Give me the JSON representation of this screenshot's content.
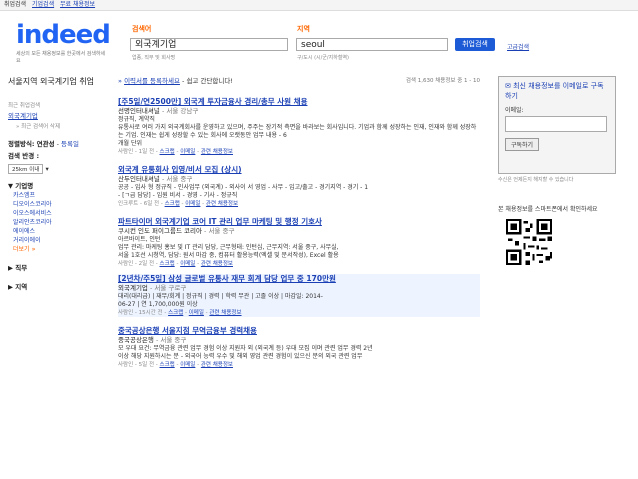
{
  "topbar": {
    "title": "취업검색",
    "links": [
      "기업검색",
      "무료 채용정보"
    ]
  },
  "logo": {
    "word": "indeed",
    "tagline": "세상의 모든 채용정보를 한곳에서 검색하세요"
  },
  "search": {
    "what_label": "검색어",
    "what_value": "외국계기업",
    "what_hint": "업종, 직무 및 회사명",
    "where_label": "지역",
    "where_value": "seoul",
    "where_hint": "구/도시 (시/군/지하철역)",
    "button": "취업검색",
    "advanced": "고급검색"
  },
  "sidebar": {
    "title": "서울지역 외국계기업 취업",
    "recent_label": "최근 취업검색",
    "recent": [
      "외국계기업"
    ],
    "recent_clear": "» 최근 검색어 삭제",
    "sort_label": "정렬방식:",
    "sort_value": "연관성",
    "sort_alt": "등록일",
    "radius_label": "검색 반경 :",
    "radius_value": "25km 이내",
    "section_type": "▼ 기업명",
    "types": [
      {
        "name": "카스엠프",
        "count": ""
      },
      {
        "name": "디오이스코리아",
        "count": ""
      },
      {
        "name": "이오스에서비스",
        "count": ""
      },
      {
        "name": "알리안츠코리아",
        "count": ""
      },
      {
        "name": "에이에스",
        "count": ""
      },
      {
        "name": "거리이에이",
        "count": ""
      },
      {
        "name": "더보기",
        "count": "»"
      }
    ],
    "section_job": "▶ 직무",
    "section_area": "▶ 지역"
  },
  "results": {
    "register": "이력서를 등록하세요",
    "register_tail": "- 쉽고 간단합니다!",
    "count": "검색 1,630 채용정보 중 1 - 10",
    "jobs": [
      {
        "title": "[주5일/연2500만] 외국계 투자금융사 경리/총무 사원 채용",
        "company": "선명인터내셔널",
        "location": "- 서울 강남구",
        "desc": [
          "정규직, 계약직",
          "유통사로 여러 가지 외국계회사를 운영하고 있으며, 주주는 장기적 측면을 바라보는 회사입니다. 기업과 함께 성장하는 인재, 인재와 함께 성장하는 기업. 인재는 쉽게 성장할 수 있는 회사에 오랫동안 업무 내용 - 6",
          "개월 단위"
        ],
        "meta": [
          "사람인 - 1일 전",
          "스크랩",
          "이메일",
          "관련 채용정보"
        ]
      },
      {
        "title": "외국계 유통회사 입영/비서 모집 (상시)",
        "company": "산두인터내셔널",
        "location": "- 서울 중구",
        "desc": [
          "공공 - 입사 형 정규직 - 인사업무 (외국계) - 외사이 서 영업 - 사무 - 입고/출고 - 경기지역 - 경기 - 1",
          "- [ㄱ급 담당] - 임원 비서 - 경영 - 기사 - 정규직"
        ],
        "meta": [
          "인크루트 - 6일 전",
          "스크랩",
          "이메일",
          "관련 채용정보"
        ]
      },
      {
        "title": "파트타이머 외국계기업 코어 IT 관리 업무 마케팅 및 행정 기호사",
        "company": "쿠시컨 인도 퍼이그룹드 코리아",
        "location": "- 서울 중구",
        "desc": [
          "아르바이트, 인턴",
          "업무 관리: 마케팅 홍보 및 IT 관리 담당, 근무형태: 인턴십, 근무지역: 서울 중구, 사무실,",
          "서울 1호선 시청역, 담당: 원서 마감 중, 컴퓨터 활용능력(엑셀 및 문서작성), Excel 활용"
        ],
        "meta": [
          "사람인 - 2일 전",
          "스크랩",
          "이메일",
          "관련 채용정보"
        ]
      },
      {
        "title": "[2년차/주5일] 삼성 글로벌 유통사 재무 회계 담당 업무 중 170만원",
        "company": "외국계기업",
        "location": "- 서울 구로구",
        "desc": [
          "대리(대리급) | 재무/회계 | 정규직 | 경력 | 학력 무관 | 고졸 이상 | 마감일: 2014-",
          "06-27 | 연 1,700,000원 이상"
        ],
        "meta": [
          "사람인 - 15시간 전",
          "스크랩",
          "이메일",
          "관련 채용정보"
        ],
        "highlight": true
      },
      {
        "title": "중국공상은행 서울지점 무역금융부 경력채용",
        "company": "중국공상은행",
        "location": "- 서울 중구",
        "desc": [
          "모 우대 요건: 무역금융 관련 업무 경험 이상 지원자 외 (외국계 등) 우대 모집 이며 관련 업무 경력 2년",
          "이상 해당 지원하시는 분 - 외국어 능력 우수 및 해외 영업 관련 경험이 있으신 분의 외국 관련 업무"
        ],
        "meta": [
          "사람인 - 5일 전",
          "스크랩",
          "이메일",
          "관련 채용정보"
        ]
      }
    ]
  },
  "rail": {
    "alert_title": "최신 채용정보를 이메일로 구독하기",
    "email_label": "이메일:",
    "subscribe": "구독하기",
    "note": "수신은 언제든지 해지할 수 있습니다",
    "qr_text": "본 채용정보를 스마트폰에서 확인하세요"
  }
}
